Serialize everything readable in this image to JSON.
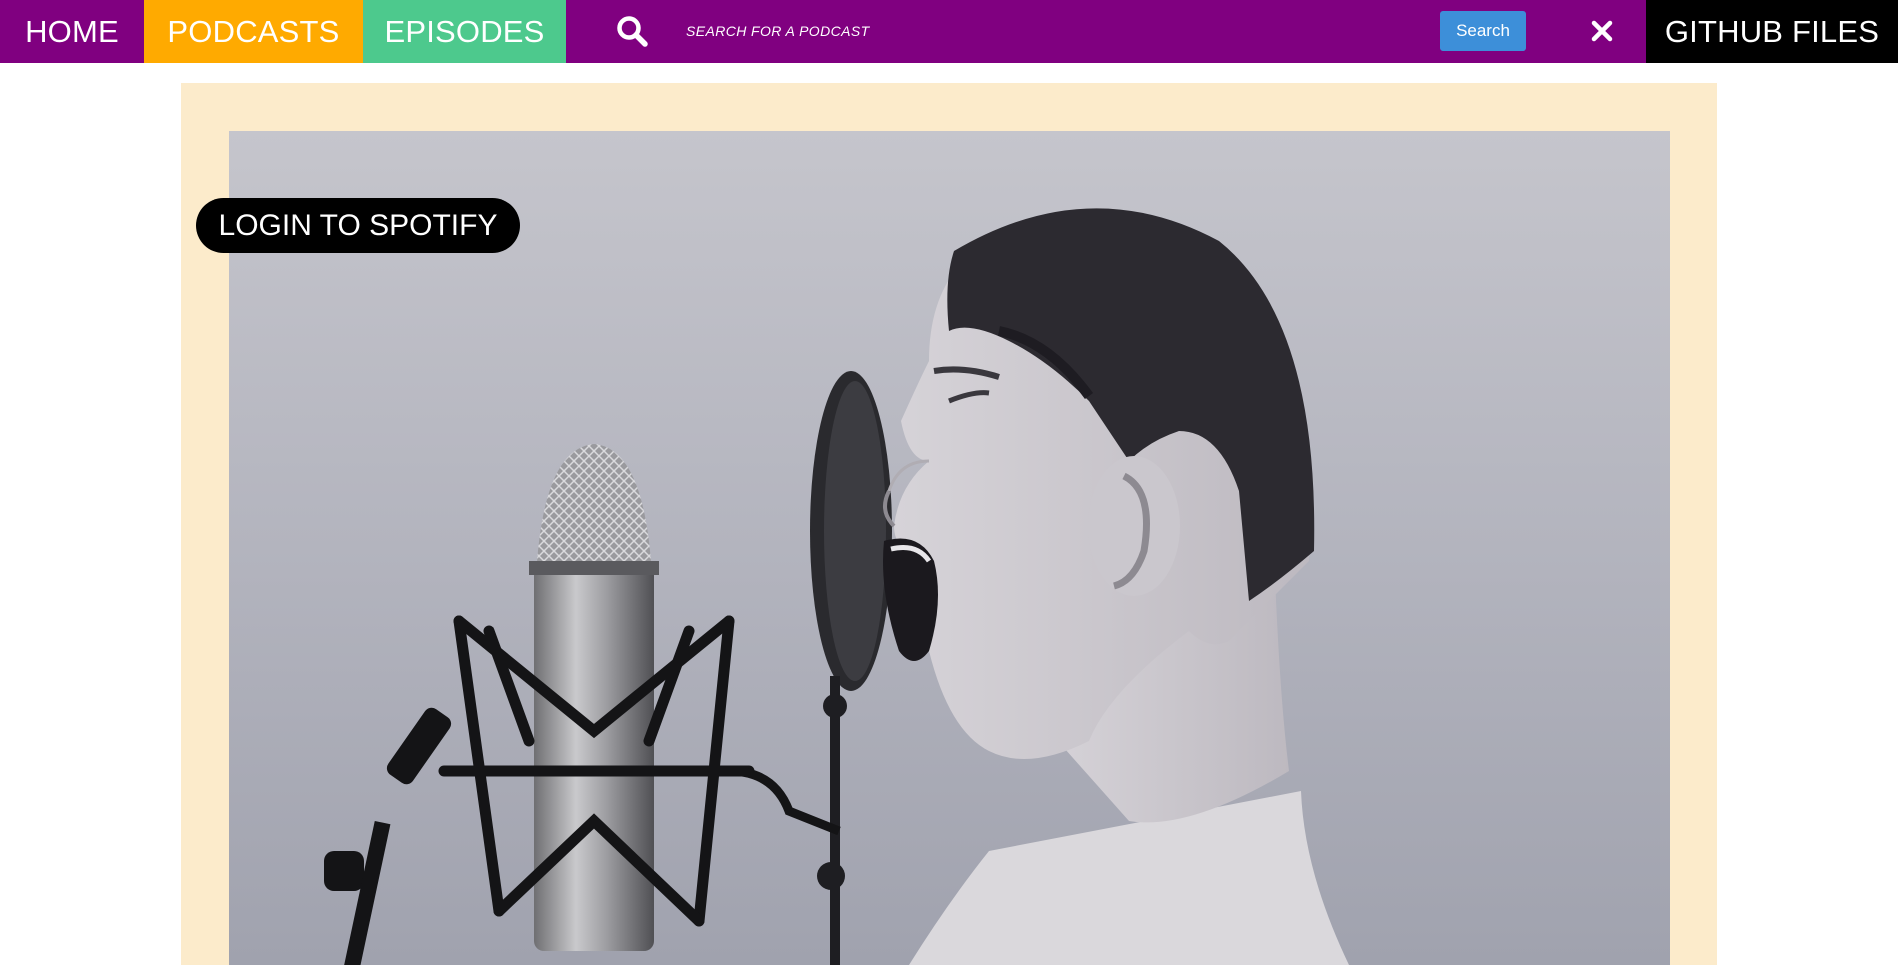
{
  "nav": {
    "home_label": "HOME",
    "podcasts_label": "PODCASTS",
    "episodes_label": "EPISODES",
    "github_label": "GITHUB FILES"
  },
  "search": {
    "icon": "search-icon",
    "placeholder": "SEARCH FOR A PODCAST",
    "value": "",
    "button_label": "Search",
    "clear_icon": "close-icon"
  },
  "hero": {
    "login_label": "LOGIN TO SPOTIFY",
    "image": "photo-child-shouting-into-microphone"
  },
  "colors": {
    "nav_background": "#800080",
    "podcasts_tab": "#FFAA00",
    "episodes_tab": "#4DC98D",
    "github_tab": "#000000",
    "search_button": "#3D8FD9",
    "hero_frame": "#FCEBCB"
  }
}
